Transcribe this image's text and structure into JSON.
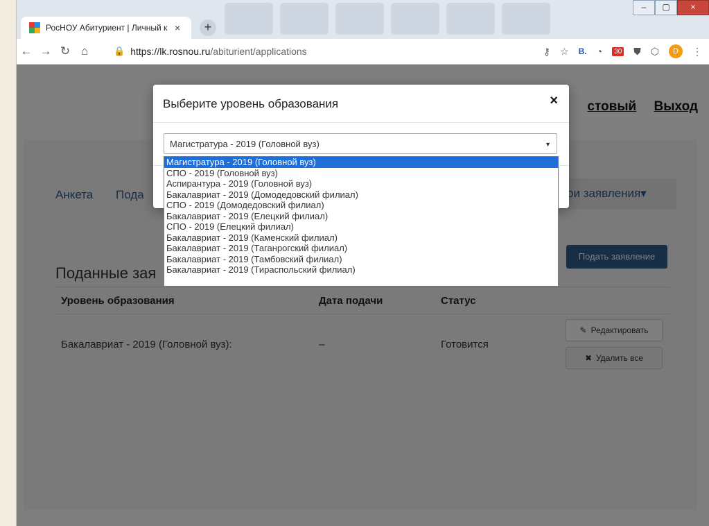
{
  "browser": {
    "tab_title": "РосНОУ Абитуриент | Личный к",
    "tab_close": "×",
    "new_tab": "+",
    "url_protocol": "https://",
    "url_host": "lk.rosnou.ru",
    "url_path": "/abiturient/applications",
    "window_controls": [
      "–",
      "▢",
      "×"
    ],
    "avatar_letter": "D",
    "calendar_badge": "30",
    "ext_b": "B."
  },
  "page": {
    "top_nav": [
      "стовый",
      "Выход"
    ],
    "menu": [
      "Анкета",
      "Пода"
    ],
    "my_menu": "ои заявления▾",
    "section_title": "Поданные зая",
    "submit_button": "Подать заявление",
    "table": {
      "headers": [
        "Уровень образования",
        "Дата подачи",
        "Статус"
      ],
      "rows": [
        {
          "level": "Бакалавриат - 2019 (Головной вуз):",
          "date": "–",
          "status": "Готовится"
        }
      ],
      "edit_button": "Редактировать",
      "delete_button": "Удалить все"
    }
  },
  "modal": {
    "title": "Выберите уровень образования",
    "close": "×",
    "selected": "Магистратура - 2019 (Головной вуз)",
    "options": [
      "Магистратура - 2019 (Головной вуз)",
      "СПО - 2019 (Головной вуз)",
      "Аспирантура - 2019 (Головной вуз)",
      "Бакалавриат - 2019 (Домодедовский филиал)",
      "СПО - 2019 (Домодедовский филиал)",
      "Бакалавриат - 2019 (Елецкий филиал)",
      "СПО - 2019 (Елецкий филиал)",
      "Бакалавриат - 2019 (Каменский филиал)",
      "Бакалавриат - 2019 (Таганрогский филиал)",
      "Бакалавриат - 2019 (Тамбовский филиал)",
      "Бакалавриат - 2019 (Тираспольский филиал)"
    ]
  },
  "colors": {
    "accent": "#2c5f8f",
    "selection": "#1e6fd9"
  }
}
